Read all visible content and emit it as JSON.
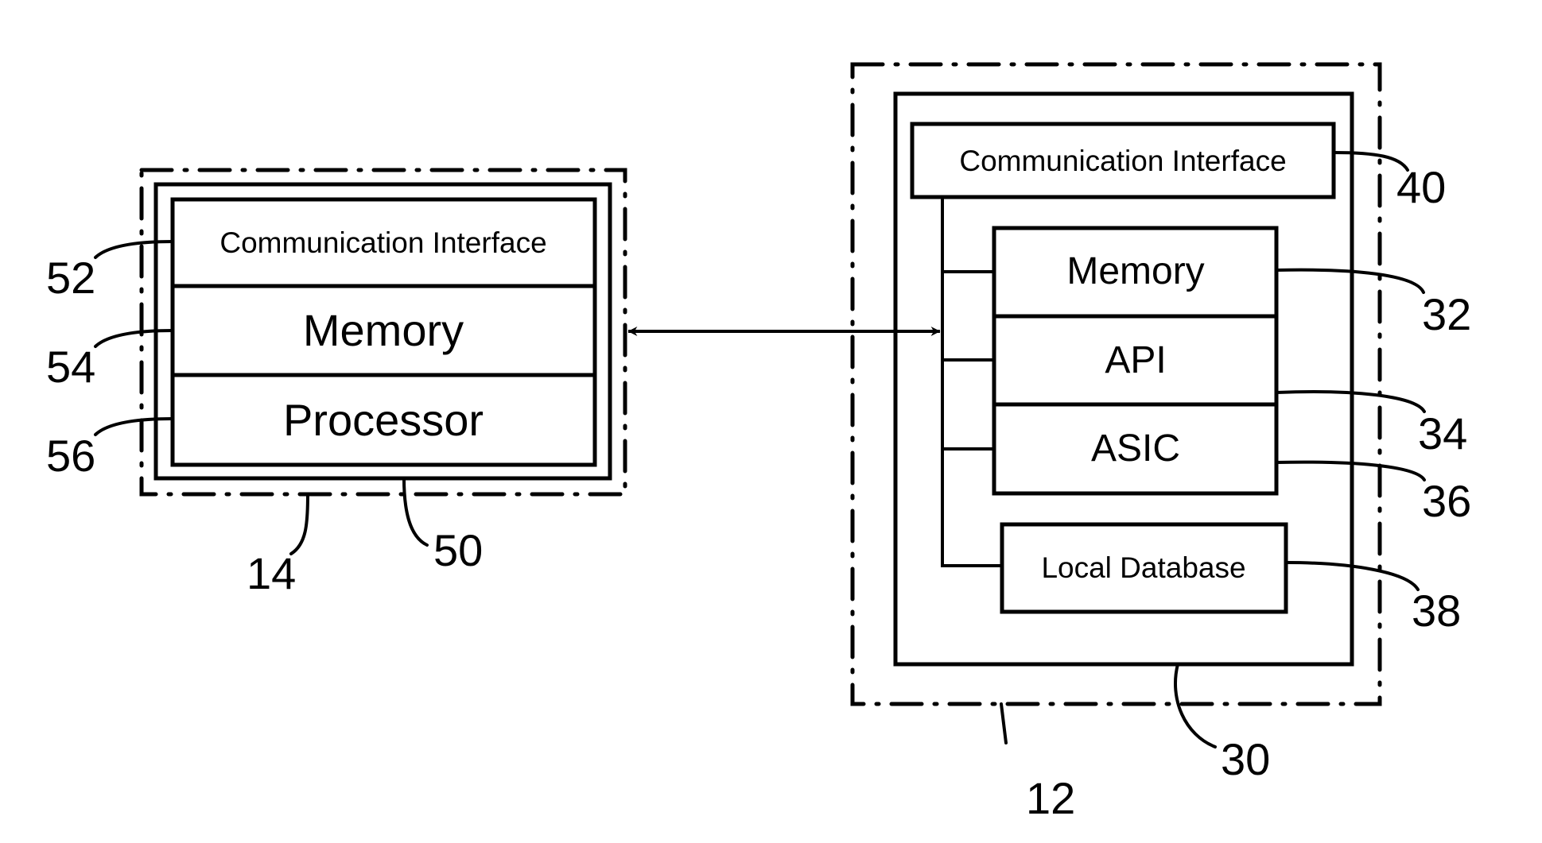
{
  "diagram": {
    "left_device": {
      "ref": "14",
      "container_ref": "50",
      "blocks": [
        {
          "label": "Communication  Interface",
          "ref": "52"
        },
        {
          "label": "Memory",
          "ref": "54"
        },
        {
          "label": "Processor",
          "ref": "56"
        }
      ]
    },
    "right_device": {
      "ref": "12",
      "container_ref": "30",
      "comm_interface": {
        "label": "Communication Interface",
        "ref": "40"
      },
      "stack": [
        {
          "label": "Memory",
          "ref": "32"
        },
        {
          "label": "API",
          "ref": "34"
        },
        {
          "label": "ASIC",
          "ref": "36"
        }
      ],
      "database": {
        "label": "Local Database",
        "ref": "38"
      }
    },
    "connection": "bidirectional"
  }
}
